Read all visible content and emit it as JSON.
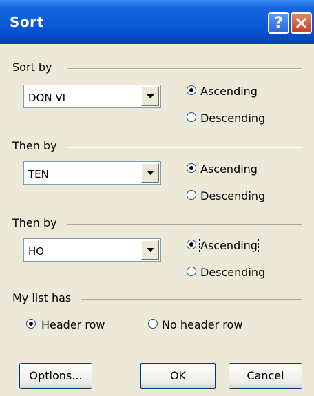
{
  "window": {
    "title": "Sort",
    "help_glyph": "?",
    "close_icon": "close-icon"
  },
  "sort_by": {
    "heading": "Sort by",
    "field_value": "DON VI",
    "ascending_label": "Ascending",
    "descending_label": "Descending",
    "selected": "ascending"
  },
  "then_by_1": {
    "heading": "Then by",
    "field_value": "TEN",
    "ascending_label": "Ascending",
    "descending_label": "Descending",
    "selected": "ascending"
  },
  "then_by_2": {
    "heading": "Then by",
    "field_value": "HO",
    "ascending_label": "Ascending",
    "descending_label": "Descending",
    "selected": "ascending"
  },
  "my_list_has": {
    "heading": "My list has",
    "header_row_label": "Header row",
    "no_header_row_label": "No header row",
    "selected": "header_row"
  },
  "buttons": {
    "options": "Options...",
    "ok": "OK",
    "cancel": "Cancel"
  },
  "colors": {
    "titlebar": "#0a5ad8",
    "dialog_bg": "#ece9d8",
    "close_button": "#c6401f",
    "field_border": "#7f9db9"
  }
}
